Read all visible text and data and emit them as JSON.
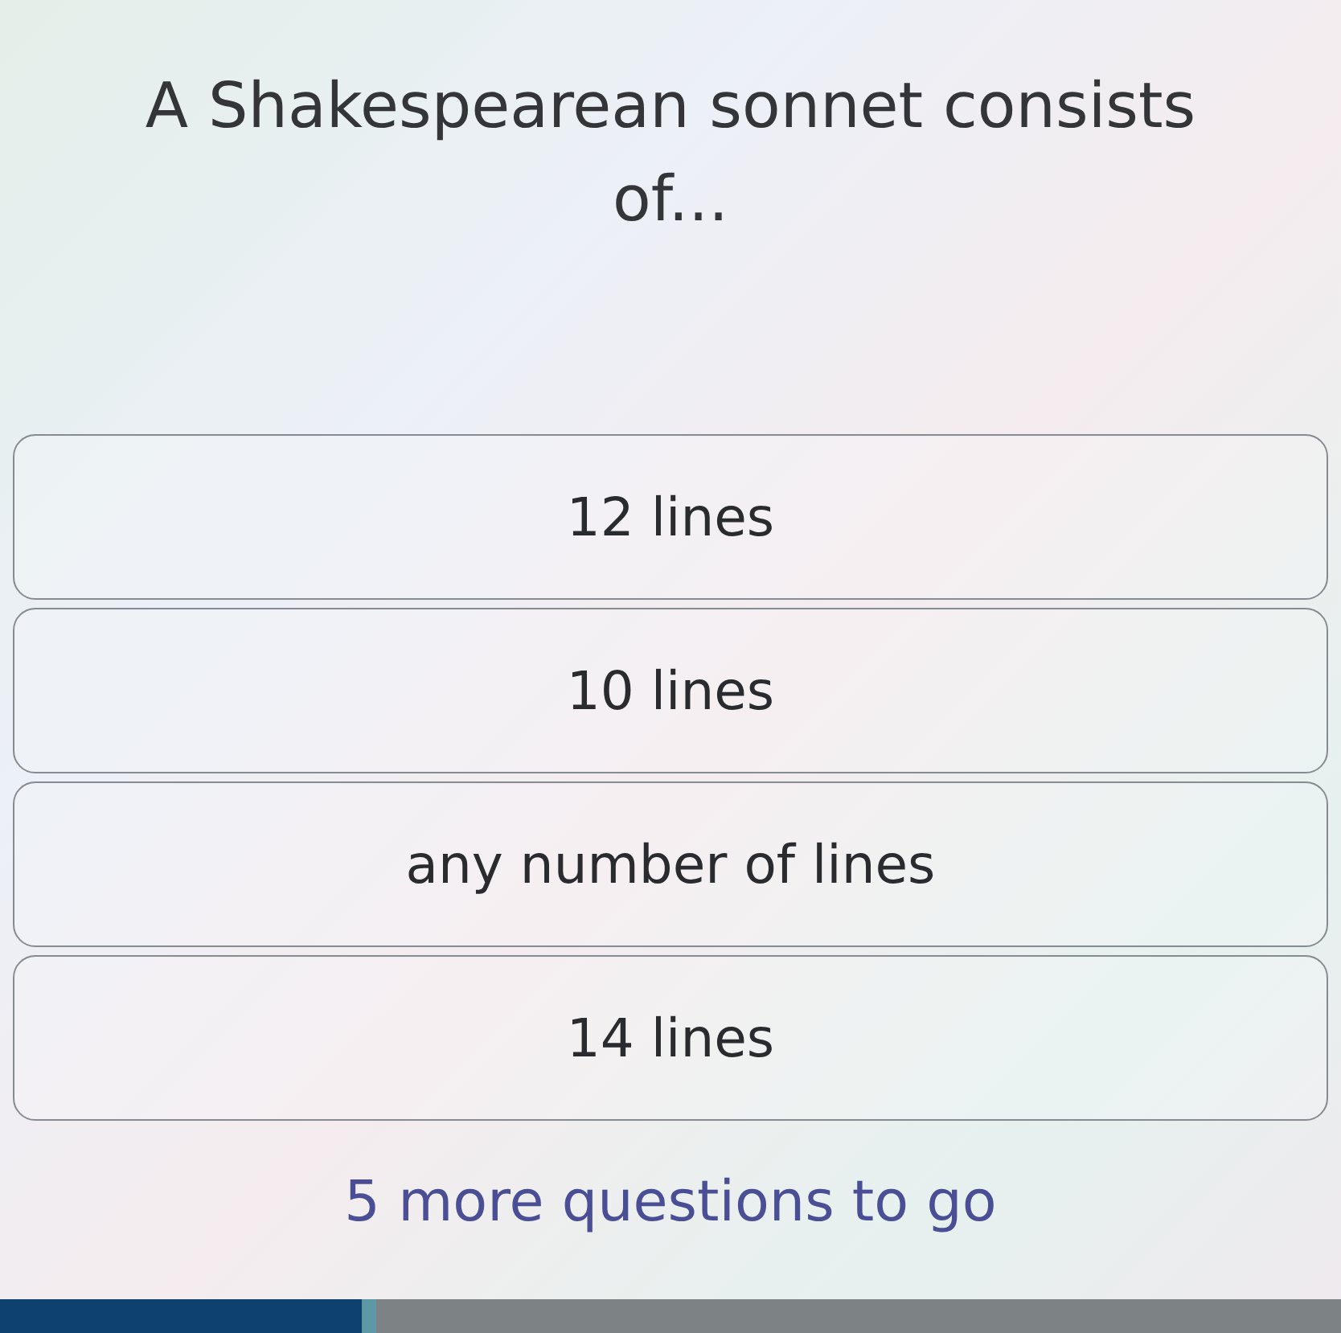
{
  "question": "A Shakespearean sonnet consists of...",
  "options": [
    {
      "label": "12 lines"
    },
    {
      "label": "10 lines"
    },
    {
      "label": "any number of lines"
    },
    {
      "label": "14 lines"
    }
  ],
  "footer": "5 more questions to go",
  "progress": {
    "level": 0.28
  }
}
